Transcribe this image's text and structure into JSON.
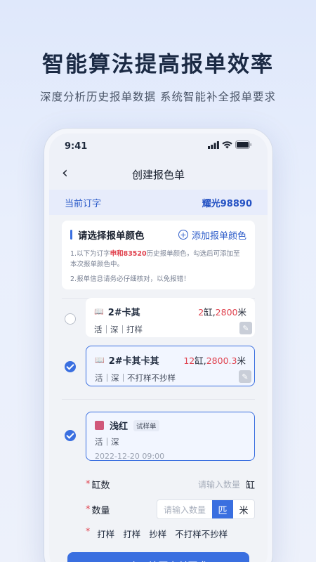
{
  "hero": {
    "title": "智能算法提高报单效率",
    "subtitle": "深度分析历史报单数据  系统智能补全报单要求"
  },
  "status": {
    "time": "9:41",
    "signal_icon": "signal-icon",
    "wifi_icon": "wifi-icon",
    "battery_icon": "battery-icon"
  },
  "nav": {
    "title": "创建报色单",
    "back_icon": "chevron-left-icon"
  },
  "order": {
    "label": "当前订字",
    "value": "耀光98890"
  },
  "notice": {
    "title": "请选择报单颜色",
    "add_label": "添加报单颜色",
    "line1_pre": "1.以下为订字",
    "line1_highlight": "申和83520",
    "line1_post": "历史报单颜色，勾选后可添加至本次报单颜色中。",
    "line2": "2.报单信息请务必仔细核对，以免报错！"
  },
  "cards": [
    {
      "name": "2#卡其",
      "qty_count": "2",
      "qty_unit1": "缸,",
      "qty_amount": "2800",
      "qty_unit2": "米",
      "sub": "活｜深｜打样",
      "checked": false
    },
    {
      "name": "2#卡其卡其",
      "qty_count": "12",
      "qty_unit1": "缸,",
      "qty_amount": "2800.3",
      "qty_unit2": "米",
      "sub": "活｜深｜不打样不抄样",
      "checked": true
    }
  ],
  "sample": {
    "name": "浅红",
    "tag": "试样单",
    "sub": "活｜深",
    "date": "2022-12-20 09:00",
    "swatch_color": "#d0587a"
  },
  "form": {
    "vat_label": "缸数",
    "vat_placeholder": "请输入数量",
    "vat_unit": "缸",
    "qty_label": "数量",
    "qty_placeholder": "请输入数量",
    "unit_piece": "匹",
    "unit_meter": "米",
    "options": [
      "打样",
      "打样",
      "抄样",
      "不打样不抄样"
    ]
  },
  "next_button": "下一步，填写交付要求",
  "colors": {
    "accent": "#3a6fe0",
    "danger": "#e0434f"
  }
}
